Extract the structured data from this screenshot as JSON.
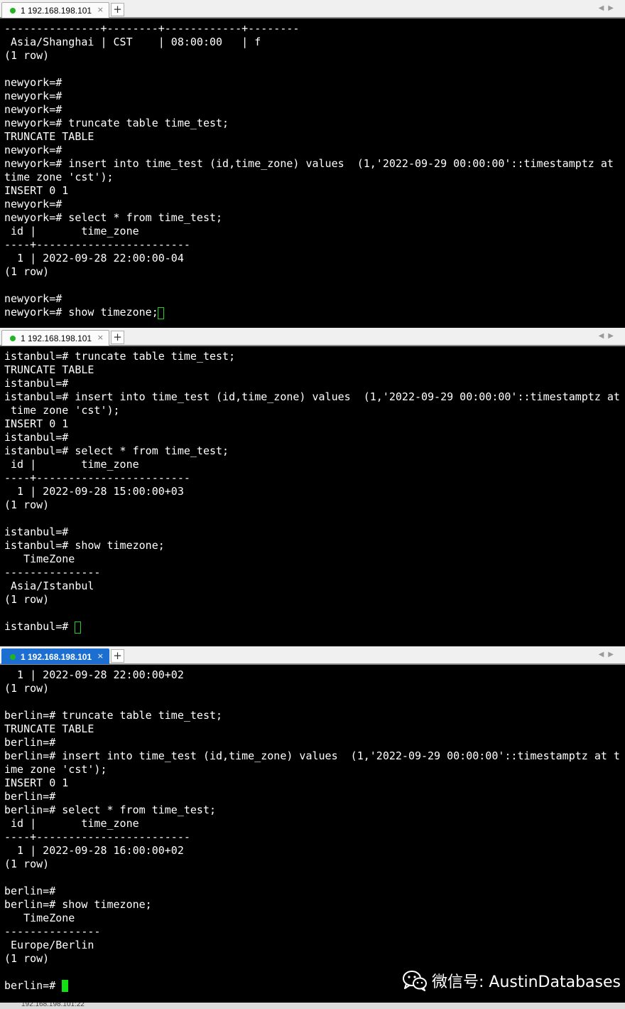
{
  "panes": [
    {
      "tab": {
        "label": "1 192.168.198.101",
        "close": "×",
        "active": false
      },
      "add_tab": "+",
      "lines": [
        "---------------+--------+------------+--------",
        " Asia/Shanghai | CST    | 08:00:00   | f",
        "(1 row)",
        "",
        "newyork=#",
        "newyork=#",
        "newyork=#",
        "newyork=# truncate table time_test;",
        "TRUNCATE TABLE",
        "newyork=#",
        "newyork=# insert into time_test (id,time_zone) values  (1,'2022-09-29 00:00:00'::timestamptz at",
        "time zone 'cst');",
        "INSERT 0 1",
        "newyork=#",
        "newyork=# select * from time_test;",
        " id |       time_zone",
        "----+------------------------",
        "  1 | 2022-09-28 22:00:00-04",
        "(1 row)",
        "",
        "newyork=#",
        "newyork=# show timezone;"
      ]
    },
    {
      "tab": {
        "label": "1 192.168.198.101",
        "close": "×",
        "active": false
      },
      "add_tab": "+",
      "lines": [
        "istanbul=# truncate table time_test;",
        "TRUNCATE TABLE",
        "istanbul=#",
        "istanbul=# insert into time_test (id,time_zone) values  (1,'2022-09-29 00:00:00'::timestamptz at",
        " time zone 'cst');",
        "INSERT 0 1",
        "istanbul=#",
        "istanbul=# select * from time_test;",
        " id |       time_zone",
        "----+------------------------",
        "  1 | 2022-09-28 15:00:00+03",
        "(1 row)",
        "",
        "istanbul=#",
        "istanbul=# show timezone;",
        "   TimeZone",
        "---------------",
        " Asia/Istanbul",
        "(1 row)",
        "",
        "istanbul=# "
      ]
    },
    {
      "tab": {
        "label": "1 192.168.198.101",
        "close": "×",
        "active": true
      },
      "add_tab": "+",
      "lines": [
        "  1 | 2022-09-28 22:00:00+02",
        "(1 row)",
        "",
        "berlin=# truncate table time_test;",
        "TRUNCATE TABLE",
        "berlin=#",
        "berlin=# insert into time_test (id,time_zone) values  (1,'2022-09-29 00:00:00'::timestamptz at t",
        "ime zone 'cst');",
        "INSERT 0 1",
        "berlin=#",
        "berlin=# select * from time_test;",
        " id |       time_zone",
        "----+------------------------",
        "  1 | 2022-09-28 16:00:00+02",
        "(1 row)",
        "",
        "berlin=#",
        "berlin=# show timezone;",
        "   TimeZone",
        "---------------",
        " Europe/Berlin",
        "(1 row)",
        "",
        "berlin=# "
      ]
    }
  ],
  "watermark": {
    "text": "微信号: AustinDatabases",
    "icon": "wechat-icon"
  },
  "status_bar": {
    "text": "192.168.198.101:22"
  },
  "colors": {
    "terminal_bg": "#000000",
    "terminal_fg": "#ffffff",
    "cursor": "#13e013",
    "active_tab": "#1c6fd1",
    "connected_dot": "#22b422"
  }
}
